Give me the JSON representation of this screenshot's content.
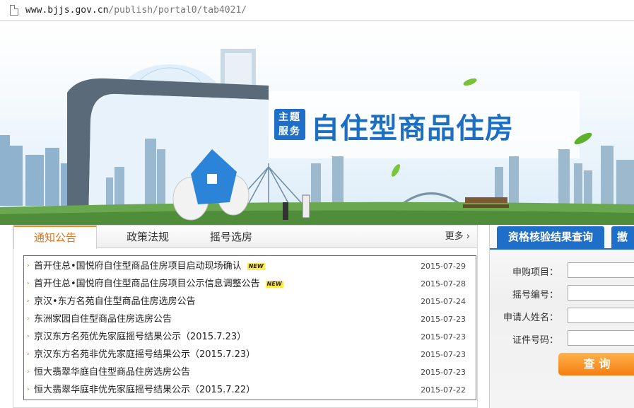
{
  "browser": {
    "url_host": "www.bjjs.gov.cn",
    "url_path": "/publish/portal0/tab4021/"
  },
  "banner": {
    "badge_line1": "主题",
    "badge_line2": "服务",
    "title": "自住型商品住房"
  },
  "news": {
    "tabs": [
      {
        "label": "通知公告",
        "active": true
      },
      {
        "label": "政策法规",
        "active": false
      },
      {
        "label": "摇号选房",
        "active": false
      }
    ],
    "more_label": "更多",
    "items": [
      {
        "title": "首开住总•国悦府自住型商品住房项目启动现场确认",
        "new": true,
        "date": "2015-07-29"
      },
      {
        "title": "首开住总•国悦府自住型商品住房项目公示信息调整公告",
        "new": true,
        "date": "2015-07-28"
      },
      {
        "title": "京汉•东方名苑自住型商品住房选房公告",
        "new": false,
        "date": "2015-07-24"
      },
      {
        "title": "东洲家园自住型商品住房选房公告",
        "new": false,
        "date": "2015-07-23"
      },
      {
        "title": "京汉东方名苑优先家庭摇号结果公示（2015.7.23）",
        "new": false,
        "date": "2015-07-23"
      },
      {
        "title": "京汉东方名苑非优先家庭摇号结果公示（2015.7.23）",
        "new": false,
        "date": "2015-07-23"
      },
      {
        "title": "恒大翡翠华庭自住型商品住房选房公告",
        "new": false,
        "date": "2015-07-23"
      },
      {
        "title": "恒大翡翠华庭非优先家庭摇号结果公示（2015.7.22）",
        "new": false,
        "date": "2015-07-22"
      }
    ],
    "new_label": "NEW"
  },
  "query": {
    "tab_active": "资格核验结果查询",
    "tab_other": "撤",
    "fields": [
      {
        "label": "申购项目：",
        "value": ""
      },
      {
        "label": "摇号编号：",
        "value": ""
      },
      {
        "label": "申请人姓名：",
        "value": ""
      },
      {
        "label": "证件号码：",
        "value": ""
      }
    ],
    "button_label": "查询"
  },
  "colors": {
    "accent_blue": "#1f6ec7",
    "tab_orange": "#ef8a1c",
    "list_border": "#e04040",
    "button_orange": "#f47e12"
  }
}
